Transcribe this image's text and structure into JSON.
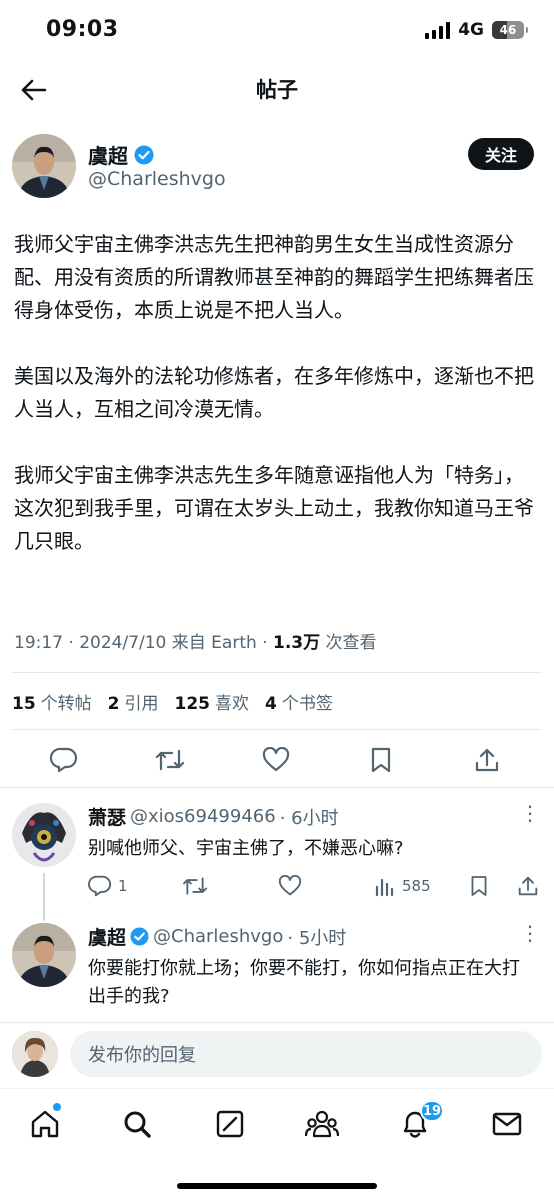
{
  "status_bar": {
    "time": "09:03",
    "network": "4G",
    "battery_level": "46"
  },
  "header": {
    "title": "帖子"
  },
  "author": {
    "name": "虞超",
    "handle": "@Charleshvgo",
    "follow_label": "关注"
  },
  "tweet": {
    "paragraphs": [
      "我师父宇宙主佛李洪志先生把神韵男生女生当成性资源分配、用没有资质的所谓教师甚至神韵的舞蹈学生把练舞者压得身体受伤，本质上说是不把人当人。",
      "美国以及海外的法轮功修炼者，在多年修炼中，逐渐也不把人当人，互相之间冷漠无情。",
      "我师父宇宙主佛李洪志先生多年随意诬指他人为「特务」，这次犯到我手里，可谓在太岁头上动土，我教你知道马王爷几只眼。"
    ],
    "time": "19:17 · 2024/7/10 来自 Earth · ",
    "views_count": "1.3万",
    "views_label": " 次查看"
  },
  "stats": {
    "reposts_count": "15",
    "reposts_label": "个转帖",
    "quotes_count": "2",
    "quotes_label": "引用",
    "likes_count": "125",
    "likes_label": "喜欢",
    "bookmarks_count": "4",
    "bookmarks_label": "个书签"
  },
  "replies": [
    {
      "name": "萧瑟",
      "handle": "@xios69499466",
      "time": "· 6小时",
      "text": "别喊他师父、宇宙主佛了，不嫌恶心嘛?",
      "reply_count": "1",
      "views": "585"
    },
    {
      "name": "虞超",
      "handle": "@Charleshvgo",
      "time": "· 5小时",
      "text": "你要能打你就上场；你要不能打，你如何指点正在大打出手的我?"
    }
  ],
  "compose": {
    "placeholder": "发布你的回复"
  },
  "tabbar": {
    "notifications_badge": "19"
  },
  "colors": {
    "accent": "#1d9bf0",
    "text": "#0f1419",
    "secondary": "#536471"
  },
  "icons": [
    "back-arrow-icon",
    "verified-icon",
    "reply-icon",
    "repost-icon",
    "like-icon",
    "bookmark-icon",
    "share-icon",
    "views-icon",
    "more-icon",
    "home-icon",
    "search-icon",
    "grok-icon",
    "communities-icon",
    "bell-icon",
    "mail-icon"
  ]
}
